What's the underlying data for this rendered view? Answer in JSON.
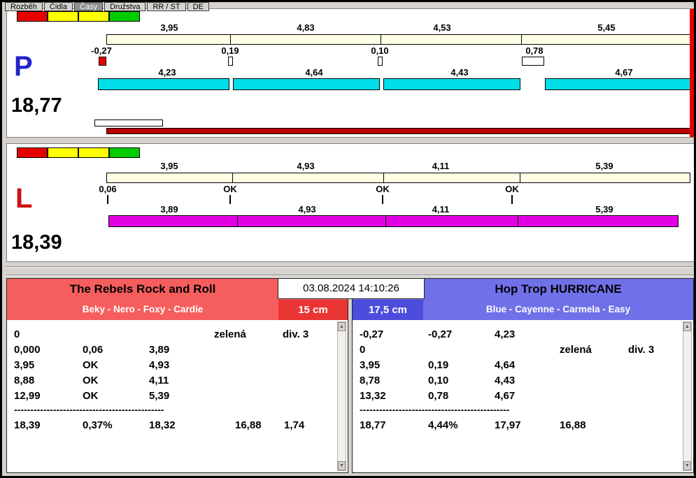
{
  "tabs": [
    "Rozběh",
    "Čidla",
    "Časy",
    "Družstva",
    "RR / ST",
    "DE"
  ],
  "active_tab_index": 2,
  "colors": {
    "cream_bar": "#ffffe6",
    "cyan_bar": "#00dfe8",
    "magenta_bar": "#e400e4",
    "red_bar": "#bb0000",
    "light_red": "#e80000",
    "light_yellow": "#ffff00",
    "light_green": "#00cc00",
    "lane_p_color": "#2222cc",
    "lane_l_color": "#cc1111",
    "team_left_bg": "#f65e5e",
    "team_left_accent": "#e93434",
    "team_right_bg": "#7070e8",
    "team_right_accent": "#4d4ddd"
  },
  "lane_p": {
    "letter": "P",
    "total": "18,77",
    "splits_top": [
      "3,95",
      "4,83",
      "4,53",
      "5,45"
    ],
    "reactions": [
      "-0,27",
      "0,19",
      "0,10",
      "0,78"
    ],
    "splits_bottom": [
      "4,23",
      "4,64",
      "4,43",
      "4,67"
    ]
  },
  "lane_l": {
    "letter": "L",
    "total": "18,39",
    "splits_top": [
      "3,95",
      "4,93",
      "4,11",
      "5,39"
    ],
    "reactions": [
      "0,06",
      "OK",
      "OK",
      "OK"
    ],
    "splits_bottom": [
      "3,89",
      "4,93",
      "4,11",
      "5,39"
    ]
  },
  "datetime": "03.08.2024 14:10:26",
  "team_left": {
    "name": "The Rebels Rock and Roll",
    "dogs": "Beky - Nero - Foxy - Cardie",
    "jump_height": "15 cm",
    "rows": [
      [
        "0",
        "",
        "",
        "zelená",
        "div. 3"
      ],
      [
        "0,000",
        "0,06",
        "3,89",
        "",
        ""
      ],
      [
        "3,95",
        "OK",
        "4,93",
        "",
        ""
      ],
      [
        "8,88",
        "OK",
        "4,11",
        "",
        ""
      ],
      [
        "12,99",
        "OK",
        "5,39",
        "",
        ""
      ]
    ],
    "separator": "----------------------------------------------",
    "totals": [
      "18,39",
      "0,37%",
      "18,32",
      "16,88",
      "1,74"
    ]
  },
  "team_right": {
    "name": "Hop Trop HURRICANE",
    "dogs": "Blue - Cayenne - Carmela - Easy",
    "jump_height": "17,5 cm",
    "rows": [
      [
        "-0,27",
        "-0,27",
        "4,23",
        "",
        ""
      ],
      [
        "0",
        "",
        "",
        "zelená",
        "div. 3"
      ],
      [
        "3,95",
        "0,19",
        "4,64",
        "",
        ""
      ],
      [
        "8,78",
        "0,10",
        "4,43",
        "",
        ""
      ],
      [
        "13,32",
        "0,78",
        "4,67",
        "",
        ""
      ]
    ],
    "separator": "----------------------------------------------",
    "totals": [
      "18,77",
      "4,44%",
      "17,97",
      "16,88",
      ""
    ]
  }
}
